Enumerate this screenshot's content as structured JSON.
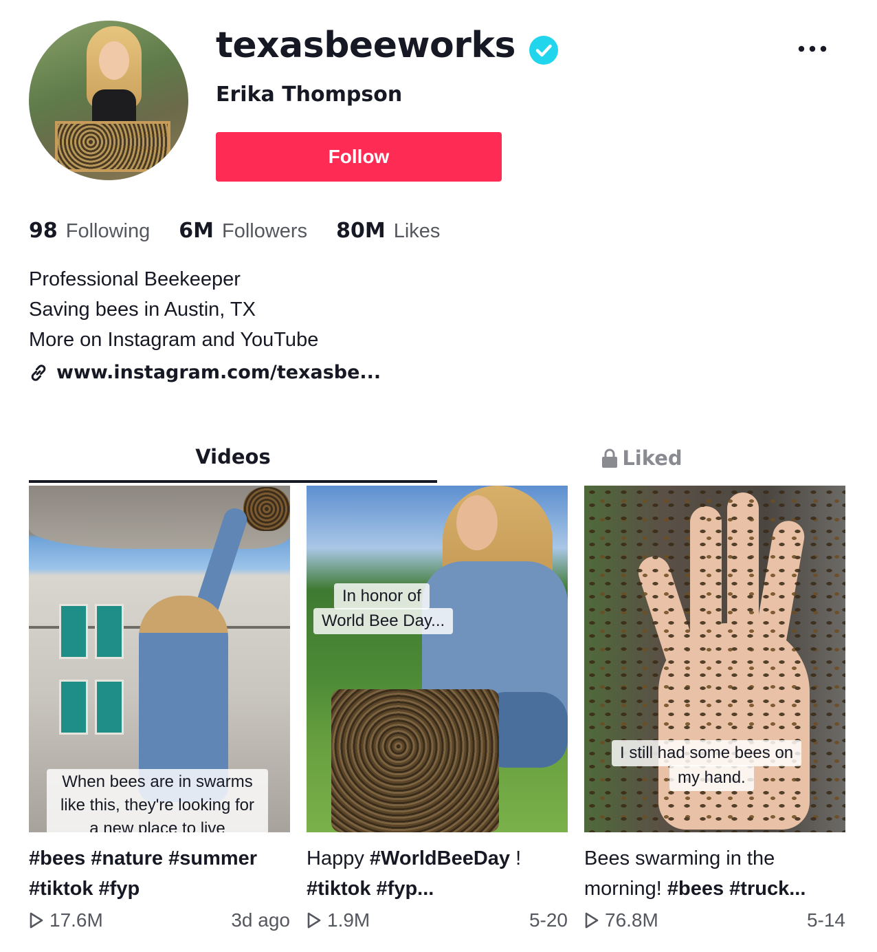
{
  "profile": {
    "username": "texasbeeworks",
    "nickname": "Erika Thompson",
    "follow_label": "Follow",
    "verified_icon": "verified-check-icon",
    "more_icon": "more-horizontal-icon"
  },
  "stats": [
    {
      "value": "98",
      "label": "Following"
    },
    {
      "value": "6M",
      "label": "Followers"
    },
    {
      "value": "80M",
      "label": "Likes"
    }
  ],
  "bio": {
    "lines": [
      "Professional Beekeeper",
      "Saving bees in Austin, TX",
      "More on Instagram and YouTube"
    ],
    "link": "www.instagram.com/texasbe..."
  },
  "tabs": {
    "videos": "Videos",
    "liked": "Liked"
  },
  "videos": [
    {
      "overlay": "When bees are in swarms like this, they're looking for a new place to live",
      "desc_parts": [
        "#bees #nature #summer",
        "#tiktok #fyp"
      ],
      "views": "17.6M",
      "date": "3d ago"
    },
    {
      "overlay_lines": [
        "In honor of",
        "World Bee Day..."
      ],
      "desc_plain": "Happy ",
      "desc_tag": "#WorldBeeDay",
      "desc_end": " !",
      "desc_line2": "#tiktok #fyp...",
      "views": "1.9M",
      "date": "5-20"
    },
    {
      "overlay_lines": [
        "I still had some bees on",
        "my hand."
      ],
      "desc_line1": "Bees swarming in the",
      "desc_plain2": "morning! ",
      "desc_tags2": "#bees #truck...",
      "views": "76.8M",
      "date": "5-14"
    }
  ],
  "colors": {
    "accent": "#fe2c55",
    "verified": "#20d5ec",
    "text_primary": "#161823",
    "text_secondary": "#55575f"
  }
}
